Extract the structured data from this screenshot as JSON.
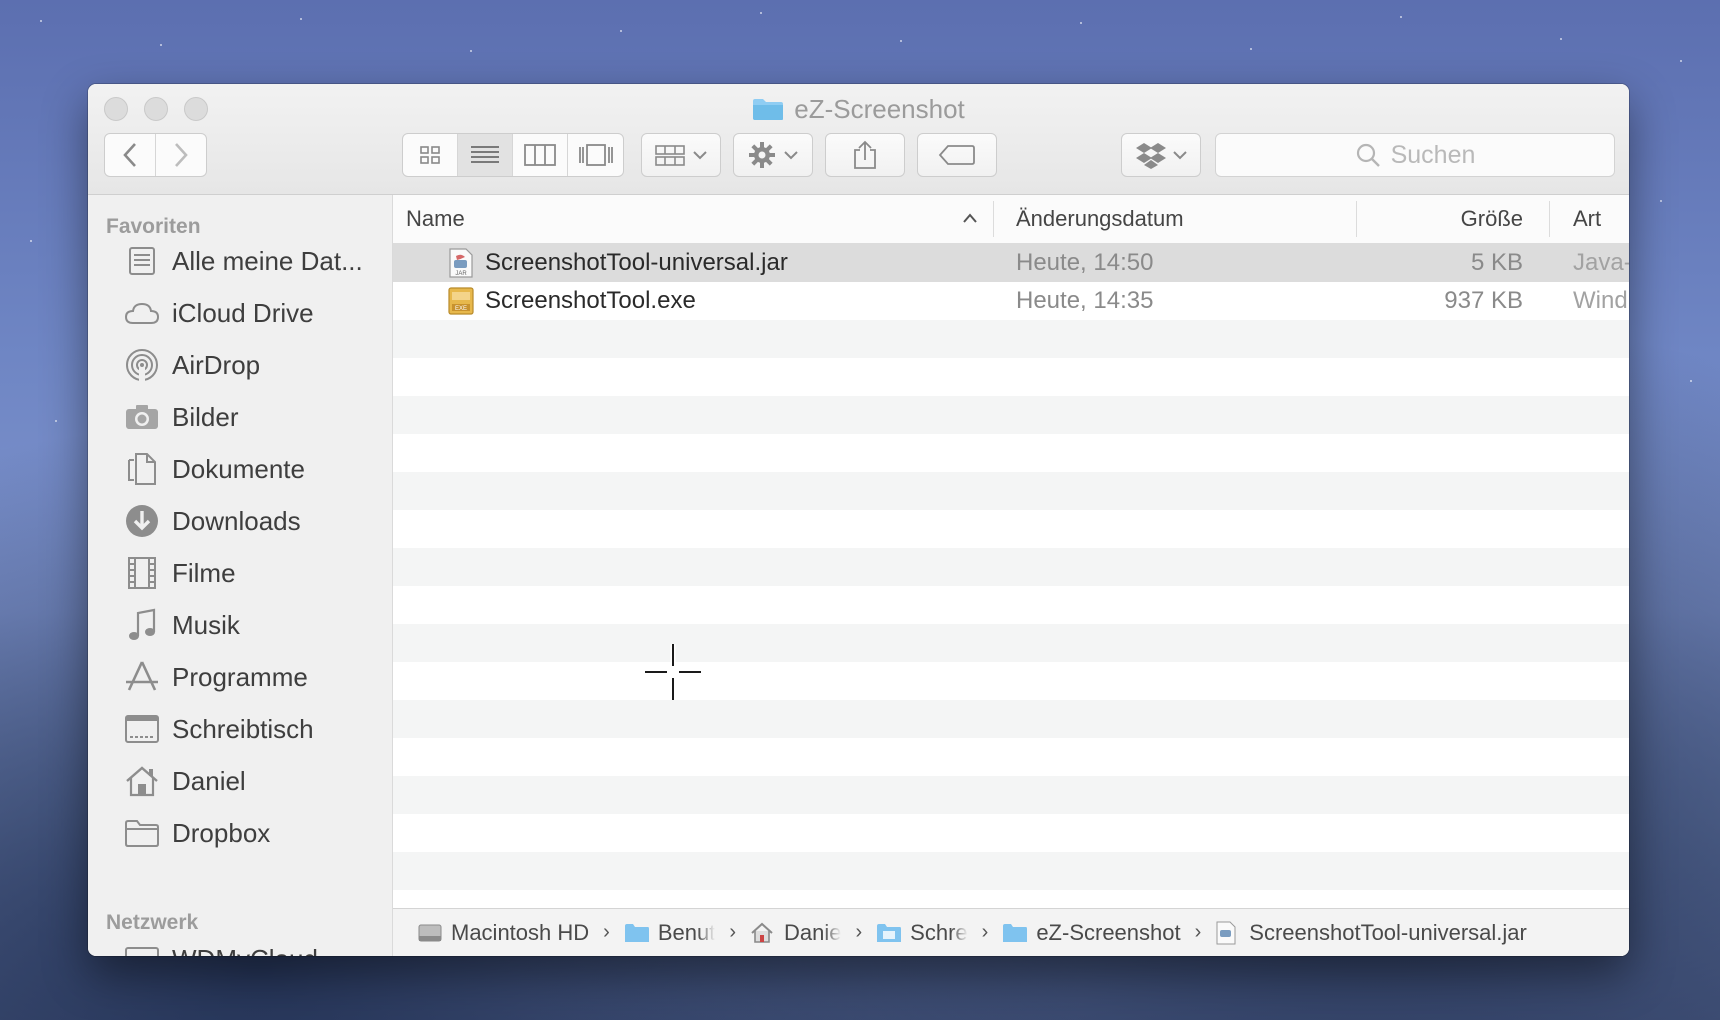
{
  "window": {
    "title": "eZ-Screenshot"
  },
  "toolbar": {
    "back_icon": "chevron-left-icon",
    "forward_icon": "chevron-right-icon",
    "view_modes": [
      "icon-view",
      "list-view",
      "column-view",
      "cover-flow-view"
    ],
    "active_view": "list-view",
    "search_placeholder": "Suchen"
  },
  "sidebar": {
    "favorites_heading": "Favoriten",
    "favorites": [
      {
        "label": "Alle meine Dat...",
        "icon": "all-files-icon"
      },
      {
        "label": "iCloud Drive",
        "icon": "cloud-icon"
      },
      {
        "label": "AirDrop",
        "icon": "airdrop-icon"
      },
      {
        "label": "Bilder",
        "icon": "camera-icon"
      },
      {
        "label": "Dokumente",
        "icon": "document-icon"
      },
      {
        "label": "Downloads",
        "icon": "download-icon"
      },
      {
        "label": "Filme",
        "icon": "film-icon"
      },
      {
        "label": "Musik",
        "icon": "music-icon"
      },
      {
        "label": "Programme",
        "icon": "apps-icon"
      },
      {
        "label": "Schreibtisch",
        "icon": "desktop-icon"
      },
      {
        "label": "Daniel",
        "icon": "home-icon"
      },
      {
        "label": "Dropbox",
        "icon": "folder-icon"
      }
    ],
    "network_heading": "Netzwerk",
    "network": [
      {
        "label": "WDMyCloud",
        "icon": "display-icon"
      }
    ]
  },
  "columns": {
    "name": "Name",
    "date": "Änderungsdatum",
    "size": "Größe",
    "kind": "Art"
  },
  "files": [
    {
      "name": "ScreenshotTool-universal.jar",
      "date": "Heute, 14:50",
      "size": "5 KB",
      "kind": "Java-",
      "icon": "jar-file-icon",
      "selected": true
    },
    {
      "name": "ScreenshotTool.exe",
      "date": "Heute, 14:35",
      "size": "937 KB",
      "kind": "Wind",
      "icon": "exe-file-icon",
      "selected": false
    }
  ],
  "pathbar": [
    {
      "label": "Macintosh HD",
      "icon": "harddisk-icon"
    },
    {
      "label": "Benut",
      "icon": "users-folder-icon"
    },
    {
      "label": "Danie",
      "icon": "home-icon"
    },
    {
      "label": "Schre",
      "icon": "desktop-folder-icon"
    },
    {
      "label": "eZ-Screenshot",
      "icon": "folder-icon"
    },
    {
      "label": "ScreenshotTool-universal.jar",
      "icon": "jar-file-icon"
    }
  ],
  "colors": {
    "folder_blue": "#7fc3ef",
    "selection": "#dcdcdc"
  }
}
